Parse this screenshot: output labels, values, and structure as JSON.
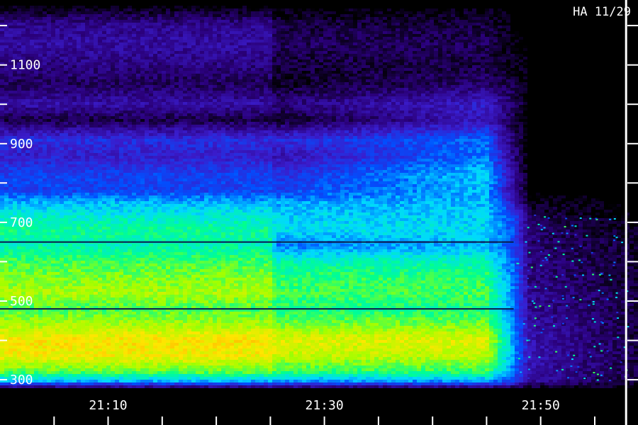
{
  "chart_data": {
    "type": "heatmap",
    "title": "",
    "annotation": "HA 11/29",
    "xlabel": "",
    "ylabel": "",
    "x_ticks": [
      {
        "value": 10,
        "label": "21:10"
      },
      {
        "value": 30,
        "label": "21:30"
      },
      {
        "value": 50,
        "label": "21:50"
      }
    ],
    "x_minor_ticks": [
      5,
      10,
      15,
      20,
      25,
      30,
      35,
      40,
      45,
      50,
      55
    ],
    "xlim": [
      0,
      59
    ],
    "xunit": "minutes after 21:00",
    "y_ticks": [
      {
        "value": 300,
        "label": "300"
      },
      {
        "value": 500,
        "label": "500"
      },
      {
        "value": 700,
        "label": "700"
      },
      {
        "value": 900,
        "label": "900"
      },
      {
        "value": 1100,
        "label": "1100"
      }
    ],
    "y_minor_ticks": [
      300,
      400,
      500,
      600,
      700,
      800,
      900,
      1000,
      1100,
      1200
    ],
    "ylim": [
      275,
      1265
    ],
    "colormap": [
      "#000000",
      "#2a007a",
      "#3a1ccc",
      "#0050ff",
      "#00d8ff",
      "#00ff90",
      "#a0ff00",
      "#ffe600",
      "#ff9a00",
      "#ff3000"
    ],
    "colormap_meaning": "intensity, low to high",
    "x_breakpoints": [
      0,
      25,
      25.5,
      45,
      47.5,
      49,
      59
    ],
    "rows": [
      {
        "y": 1250,
        "vals": [
          0.0,
          0.0,
          0.0,
          0.0,
          0.0,
          0.0,
          0.0
        ]
      },
      {
        "y": 1200,
        "vals": [
          0.14,
          0.14,
          0.06,
          0.06,
          0.0,
          0.0,
          0.0
        ]
      },
      {
        "y": 1150,
        "vals": [
          0.16,
          0.16,
          0.08,
          0.08,
          0.02,
          0.0,
          0.0
        ]
      },
      {
        "y": 1100,
        "vals": [
          0.12,
          0.12,
          0.05,
          0.06,
          0.02,
          0.0,
          0.0
        ]
      },
      {
        "y": 1050,
        "vals": [
          0.08,
          0.08,
          0.03,
          0.1,
          0.05,
          0.0,
          0.0
        ]
      },
      {
        "y": 1000,
        "vals": [
          0.17,
          0.17,
          0.12,
          0.22,
          0.1,
          0.0,
          0.0
        ]
      },
      {
        "y": 960,
        "vals": [
          0.06,
          0.06,
          0.03,
          0.2,
          0.05,
          0.0,
          0.0
        ]
      },
      {
        "y": 910,
        "vals": [
          0.26,
          0.26,
          0.26,
          0.34,
          0.1,
          0.0,
          0.0
        ]
      },
      {
        "y": 870,
        "vals": [
          0.22,
          0.22,
          0.18,
          0.36,
          0.12,
          0.0,
          0.0
        ]
      },
      {
        "y": 820,
        "vals": [
          0.3,
          0.3,
          0.26,
          0.44,
          0.15,
          0.0,
          0.0
        ]
      },
      {
        "y": 780,
        "vals": [
          0.3,
          0.3,
          0.3,
          0.42,
          0.15,
          0.0,
          0.0
        ]
      },
      {
        "y": 750,
        "vals": [
          0.42,
          0.42,
          0.4,
          0.42,
          0.22,
          0.02,
          0.0
        ]
      },
      {
        "y": 720,
        "vals": [
          0.48,
          0.48,
          0.44,
          0.44,
          0.3,
          0.06,
          0.0
        ]
      },
      {
        "y": 680,
        "vals": [
          0.55,
          0.55,
          0.46,
          0.46,
          0.32,
          0.1,
          0.02
        ]
      },
      {
        "y": 640,
        "vals": [
          0.52,
          0.52,
          0.36,
          0.42,
          0.3,
          0.1,
          0.04
        ]
      },
      {
        "y": 600,
        "vals": [
          0.6,
          0.6,
          0.52,
          0.52,
          0.34,
          0.12,
          0.04
        ]
      },
      {
        "y": 560,
        "vals": [
          0.64,
          0.64,
          0.58,
          0.58,
          0.36,
          0.12,
          0.04
        ]
      },
      {
        "y": 520,
        "vals": [
          0.68,
          0.68,
          0.6,
          0.6,
          0.38,
          0.14,
          0.06
        ]
      },
      {
        "y": 480,
        "vals": [
          0.6,
          0.6,
          0.56,
          0.56,
          0.36,
          0.14,
          0.06
        ]
      },
      {
        "y": 440,
        "vals": [
          0.68,
          0.68,
          0.64,
          0.64,
          0.38,
          0.16,
          0.06
        ]
      },
      {
        "y": 400,
        "vals": [
          0.78,
          0.78,
          0.74,
          0.74,
          0.4,
          0.18,
          0.06
        ]
      },
      {
        "y": 360,
        "vals": [
          0.76,
          0.76,
          0.7,
          0.7,
          0.4,
          0.18,
          0.06
        ]
      },
      {
        "y": 320,
        "vals": [
          0.62,
          0.62,
          0.58,
          0.58,
          0.36,
          0.18,
          0.06
        ]
      },
      {
        "y": 295,
        "vals": [
          0.4,
          0.4,
          0.38,
          0.38,
          0.3,
          0.14,
          0.04
        ]
      },
      {
        "y": 275,
        "vals": [
          0.0,
          0.0,
          0.0,
          0.0,
          0.0,
          0.0,
          0.0
        ]
      }
    ],
    "dark_lines_y": [
      650,
      480
    ],
    "vertical_marker_x": 57.9,
    "grid": false,
    "legend": "none"
  }
}
